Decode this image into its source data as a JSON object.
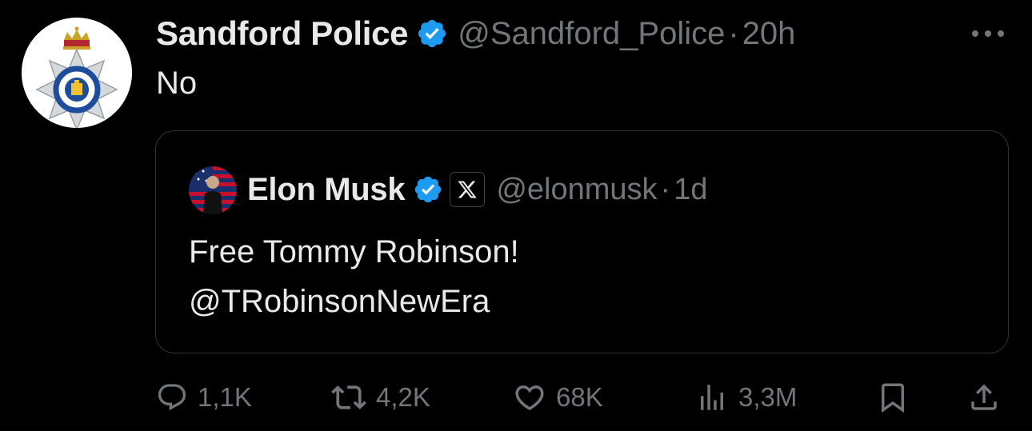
{
  "tweet": {
    "author": {
      "display_name": "Sandford Police",
      "handle": "@Sandford_Police",
      "verified": true,
      "avatar_icon": "police-crest-icon"
    },
    "separator": "·",
    "time": "20h",
    "text": "No",
    "more_icon": "more-horizontal-icon"
  },
  "quote": {
    "author": {
      "display_name": "Elon Musk",
      "handle": "@elonmusk",
      "verified": true,
      "affiliate_icon": "x-logo-icon"
    },
    "separator": "·",
    "time": "1d",
    "text_lines": [
      "Free Tommy Robinson!",
      "@TRobinsonNewEra"
    ]
  },
  "actions": {
    "reply": {
      "icon": "reply-icon",
      "count": "1,1K"
    },
    "retweet": {
      "icon": "retweet-icon",
      "count": "4,2K"
    },
    "like": {
      "icon": "heart-icon",
      "count": "68K"
    },
    "views": {
      "icon": "views-icon",
      "count": "3,3M"
    },
    "bookmark": {
      "icon": "bookmark-icon"
    },
    "share": {
      "icon": "share-icon"
    }
  },
  "colors": {
    "background": "#000000",
    "text_primary": "#e7e9ea",
    "text_secondary": "#71767b",
    "verified_blue": "#1d9bf0",
    "border": "#2f3336"
  }
}
